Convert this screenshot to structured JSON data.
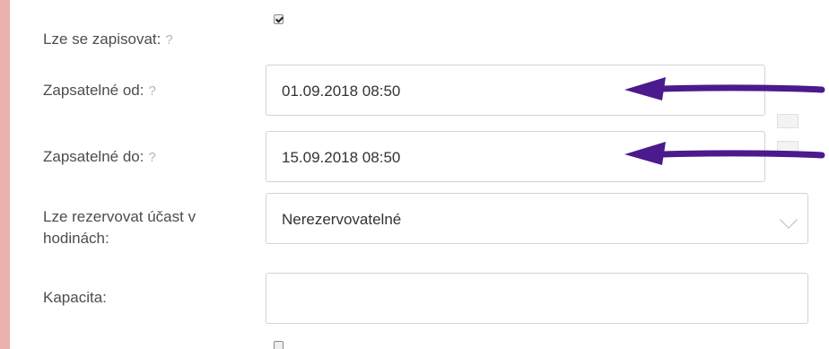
{
  "form": {
    "enrollable": {
      "label": "Lze se zapisovat:",
      "help": "?",
      "checked": true
    },
    "enrollable_from": {
      "label": "Zapsatelné od:",
      "help": "?",
      "value": "01.09.2018 08:50"
    },
    "enrollable_to": {
      "label": "Zapsatelné do:",
      "help": "?",
      "value": "15.09.2018 08:50"
    },
    "reserve_hours": {
      "label_line1": "Lze rezervovat účast v",
      "label_line2": "hodinách:",
      "value": "Nerezervovatelné"
    },
    "capacity": {
      "label": "Kapacita:",
      "value": ""
    },
    "next_checkbox": {
      "checked": false
    }
  },
  "annotation": {
    "arrow_color": "#4b1a8c"
  },
  "icons": [
    "calendar-icon",
    "chevron-down-icon",
    "arrow-left-icon"
  ]
}
